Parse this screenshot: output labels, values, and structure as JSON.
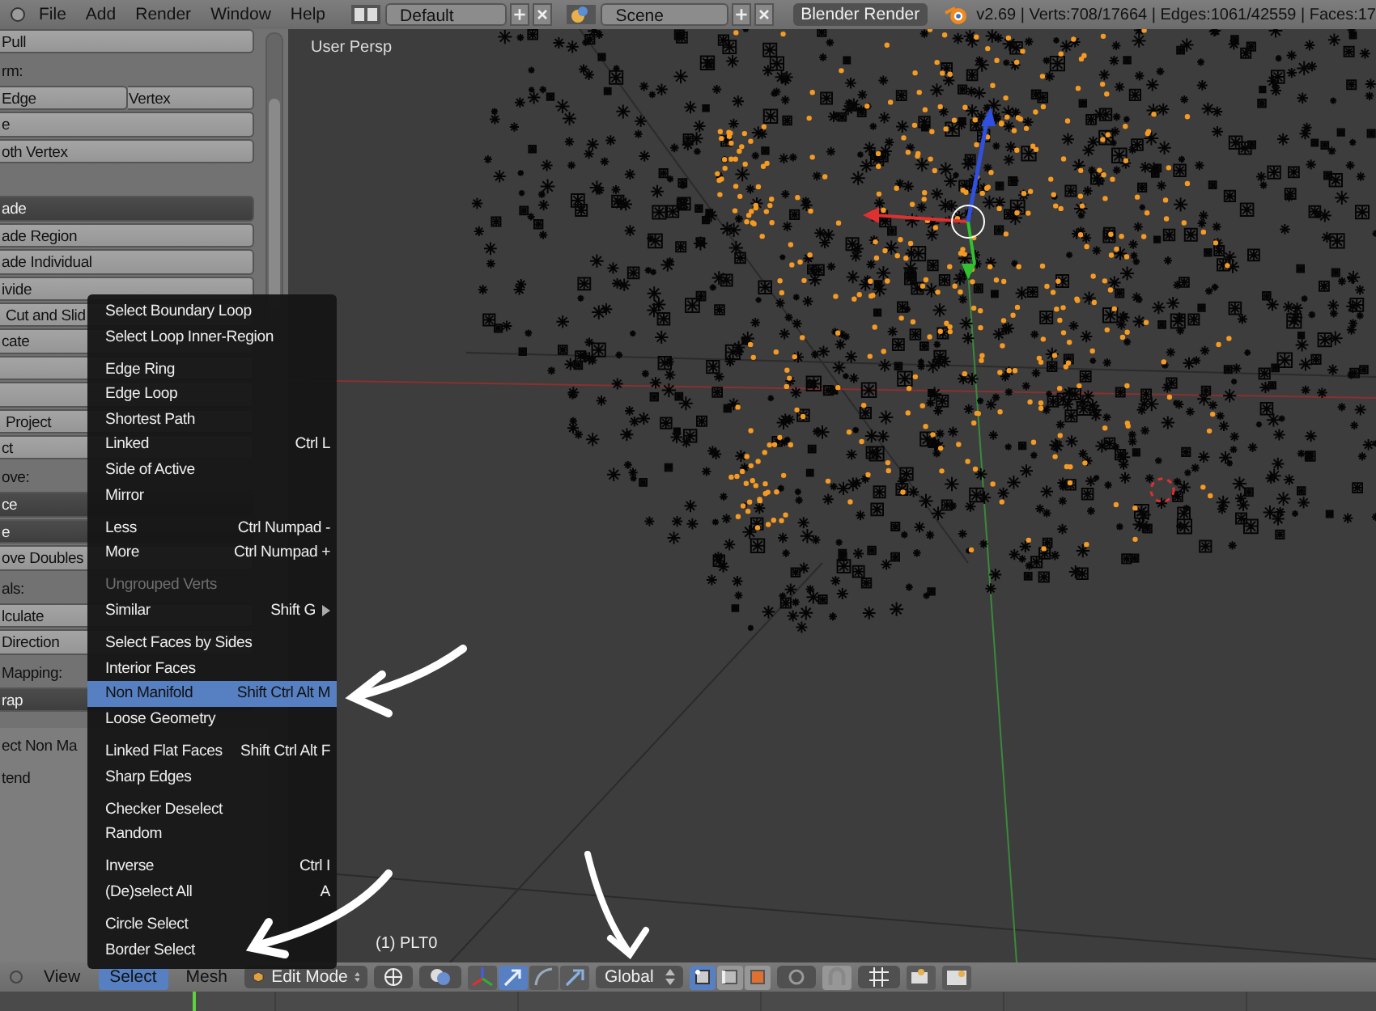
{
  "top_bar": {
    "menus": [
      "File",
      "Add",
      "Render",
      "Window",
      "Help"
    ],
    "layout": "Default",
    "scene": "Scene",
    "render_engine": "Blender Render",
    "stats": "v2.69 | Verts:708/17664 | Edges:1061/42559 | Faces:17"
  },
  "tool_panel": {
    "rows": [
      {
        "kind": "button",
        "label": "Pull"
      },
      {
        "kind": "label",
        "label": "rm:"
      },
      {
        "kind": "split",
        "labels": [
          "Edge",
          "Vertex"
        ]
      },
      {
        "kind": "button",
        "label": "e"
      },
      {
        "kind": "button",
        "label": "oth Vertex"
      },
      {
        "kind": "spacer"
      },
      {
        "kind": "dropdown",
        "label": "ade"
      },
      {
        "kind": "button",
        "label": "ade Region"
      },
      {
        "kind": "button",
        "label": "ade Individual"
      },
      {
        "kind": "button",
        "label": "ivide"
      },
      {
        "kind": "button",
        "label": " Cut and Slid"
      },
      {
        "kind": "button",
        "label": "cate"
      },
      {
        "kind": "button"
      },
      {
        "kind": "button"
      },
      {
        "kind": "button",
        "label": " Project"
      },
      {
        "kind": "button",
        "label": "ct"
      },
      {
        "kind": "label",
        "label": "ove:"
      },
      {
        "kind": "dropdown",
        "label": "ce"
      },
      {
        "kind": "dropdown",
        "label": "e"
      },
      {
        "kind": "button",
        "label": "ove Doubles"
      },
      {
        "kind": "label",
        "label": "als:"
      },
      {
        "kind": "button",
        "label": "lculate"
      },
      {
        "kind": "button",
        "label": "Direction"
      },
      {
        "kind": "label",
        "label": "Mapping:"
      },
      {
        "kind": "dropdown",
        "label": "rap"
      }
    ],
    "operator": {
      "title": "ect Non Ma",
      "options": [
        "tend"
      ]
    }
  },
  "viewport": {
    "view_label": "User Persp",
    "object_label": "(1) PLT0"
  },
  "select_menu": {
    "groups": [
      [
        {
          "label": "Select Boundary Loop",
          "disabled": false,
          "selected": false
        },
        {
          "label": "Select Loop Inner-Region",
          "disabled": false,
          "selected": false
        }
      ],
      [
        {
          "label": "Edge Ring",
          "disabled": false,
          "selected": false
        },
        {
          "label": "Edge Loop",
          "disabled": false,
          "selected": false
        },
        {
          "label": "Shortest Path",
          "disabled": false,
          "selected": false
        },
        {
          "label": "Linked",
          "shortcut": "Ctrl L",
          "disabled": false,
          "selected": false
        },
        {
          "label": "Side of Active",
          "disabled": false,
          "selected": false
        },
        {
          "label": "Mirror",
          "disabled": false,
          "selected": false
        }
      ],
      [
        {
          "label": "Less",
          "shortcut": "Ctrl Numpad -",
          "disabled": false,
          "selected": false
        },
        {
          "label": "More",
          "shortcut": "Ctrl Numpad +",
          "disabled": false,
          "selected": false
        }
      ],
      [
        {
          "label": "Ungrouped Verts",
          "disabled": true,
          "selected": false
        },
        {
          "label": "Similar",
          "shortcut": "Shift G",
          "submenu": true,
          "disabled": false,
          "selected": false
        }
      ],
      [
        {
          "label": "Select Faces by Sides",
          "disabled": false,
          "selected": false
        },
        {
          "label": "Interior Faces",
          "disabled": false,
          "selected": false
        },
        {
          "label": "Non Manifold",
          "shortcut": "Shift Ctrl Alt M",
          "disabled": false,
          "selected": true
        },
        {
          "label": "Loose Geometry",
          "disabled": false,
          "selected": false
        }
      ],
      [
        {
          "label": "Linked Flat Faces",
          "shortcut": "Shift Ctrl Alt F",
          "disabled": false,
          "selected": false
        },
        {
          "label": "Sharp Edges",
          "disabled": false,
          "selected": false
        }
      ],
      [
        {
          "label": "Checker Deselect",
          "disabled": false,
          "selected": false
        },
        {
          "label": "Random",
          "disabled": false,
          "selected": false
        }
      ],
      [
        {
          "label": "Inverse",
          "shortcut": "Ctrl I",
          "disabled": false,
          "selected": false
        },
        {
          "label": "(De)select All",
          "shortcut": "A",
          "disabled": false,
          "selected": false
        }
      ],
      [
        {
          "label": "Circle Select",
          "disabled": false,
          "selected": false
        },
        {
          "label": "Border Select",
          "disabled": false,
          "selected": false
        }
      ]
    ]
  },
  "header": {
    "menus": [
      {
        "label": "View",
        "selected": false
      },
      {
        "label": "Select",
        "selected": true
      },
      {
        "label": "Mesh",
        "selected": false
      }
    ],
    "mode": "Edit Mode",
    "manipulators": [
      {
        "kind": "axes",
        "on": false
      },
      {
        "kind": "translate",
        "on": true
      },
      {
        "kind": "rotate",
        "on": false
      },
      {
        "kind": "scale",
        "on": false
      }
    ],
    "orientation": "Global",
    "select_modes": [
      {
        "kind": "vertex",
        "selected": true
      },
      {
        "kind": "edge",
        "selected": false
      },
      {
        "kind": "face",
        "selected": false
      }
    ]
  }
}
